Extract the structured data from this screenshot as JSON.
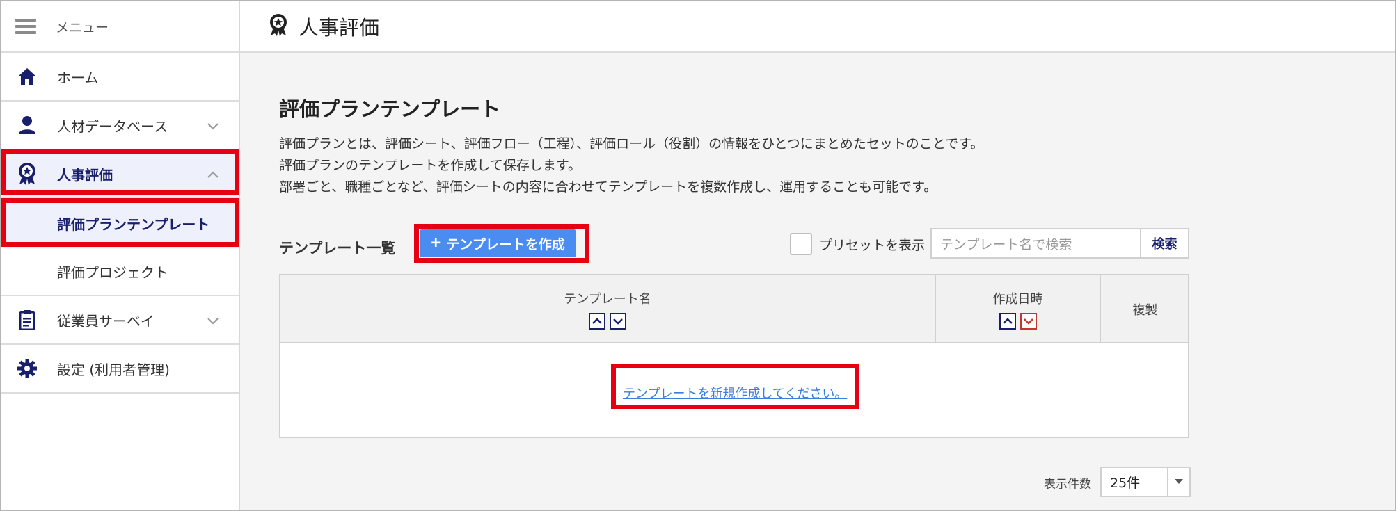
{
  "sidebar": {
    "menu_label": "メニュー",
    "items": [
      {
        "label": "ホーム",
        "icon": "home-icon"
      },
      {
        "label": "人材データベース",
        "icon": "person-icon"
      },
      {
        "label": "人事評価",
        "icon": "award-icon"
      },
      {
        "label": "従業員サーベイ",
        "icon": "clipboard-icon"
      },
      {
        "label": "設定 (利用者管理)",
        "icon": "gear-icon"
      }
    ],
    "sub_items": [
      {
        "label": "評価プランテンプレート"
      },
      {
        "label": "評価プロジェクト"
      }
    ]
  },
  "header": {
    "title": "人事評価",
    "icon": "award-icon"
  },
  "main": {
    "page_title": "評価プランテンプレート",
    "description": [
      "評価プランとは、評価シート、評価フロー（工程）、評価ロール（役割）の情報をひとつにまとめたセットのことです。",
      "評価プランのテンプレートを作成して保存します。",
      "部署ごと、職種ごとなど、評価シートの内容に合わせてテンプレートを複数作成し、運用することも可能です。"
    ],
    "list_title": "テンプレート一覧",
    "create_button": "テンプレートを作成",
    "preset_label": "プリセットを表示",
    "search_placeholder": "テンプレート名で検索",
    "search_button": "検索",
    "table": {
      "columns": [
        "テンプレート名",
        "作成日時",
        "複製"
      ],
      "empty_message": "テンプレートを新規作成してください。"
    },
    "per_page_label": "表示件数",
    "per_page_value": "25件"
  },
  "colors": {
    "accent": "#4a8cf0",
    "navy": "#1a1f6b",
    "highlight": "#e60012",
    "link": "#3b7ddd"
  }
}
